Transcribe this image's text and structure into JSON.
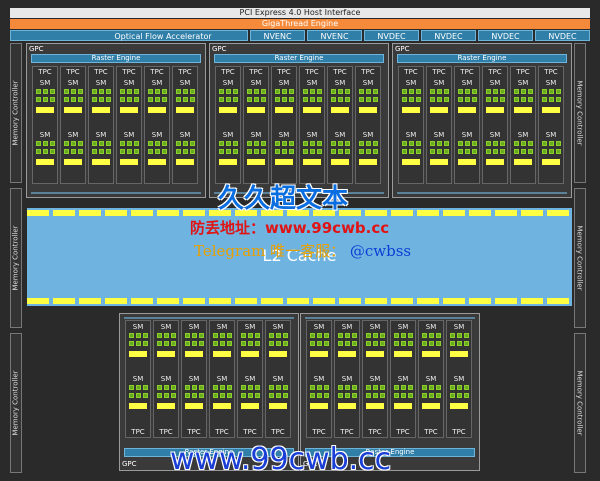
{
  "header": {
    "pcie": "PCI Express 4.0 Host Interface",
    "gigathread": "GigaThread Engine"
  },
  "engines": {
    "optical_flow": "Optical Flow Accelerator",
    "codecs": [
      "NVENC",
      "NVENC",
      "NVDEC",
      "NVDEC",
      "NVDEC",
      "NVDEC"
    ]
  },
  "memory_controller": "Memory Controller",
  "gpc": {
    "label": "GPC",
    "raster": "Raster Engine",
    "tpc": "TPC",
    "sm": "SM"
  },
  "l2": "L2 Cache",
  "watermarks": {
    "line1": "久久超文本",
    "line2": "防丢地址：www.99cwb.cc",
    "line3a": "Telegram 唯一客服：",
    "line3b": "@cwbss",
    "line4": "www.99cwb.cc"
  }
}
